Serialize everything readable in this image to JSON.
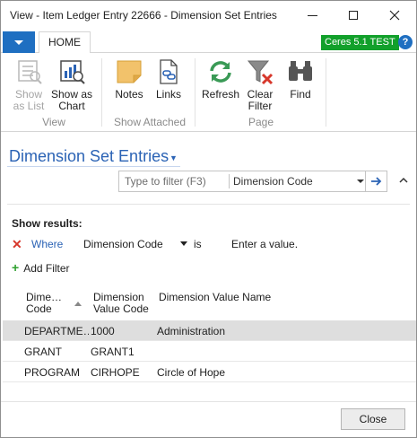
{
  "window": {
    "title": "View - Item Ledger Entry 22666 - Dimension Set Entries"
  },
  "ribbon": {
    "tab_home": "HOME",
    "env_badge": "Ceres 5.1 TEST",
    "help": "?",
    "buttons": {
      "show_as_list": "Show as List",
      "show_as_chart": "Show as Chart",
      "notes": "Notes",
      "links": "Links",
      "refresh": "Refresh",
      "clear_filter": "Clear Filter",
      "find": "Find"
    },
    "groups": {
      "view": "View",
      "show_attached": "Show Attached",
      "page": "Page"
    }
  },
  "page": {
    "title": "Dimension Set Entries",
    "search_placeholder": "Type to filter (F3)",
    "search_field": "Dimension Code"
  },
  "filters": {
    "heading": "Show results:",
    "where": "Where",
    "field": "Dimension Code",
    "operator": "is",
    "value": "Enter a value.",
    "add_filter": "Add Filter"
  },
  "grid": {
    "columns": [
      "Dime… Code",
      "Dimension Value Code",
      "Dimension Value Name"
    ],
    "col1_line1": "Dime…",
    "col1_line2": "Code",
    "col2_line1": "Dimension",
    "col2_line2": "Value Code",
    "col3_line1": "Dimension Value Name",
    "rows": [
      {
        "code": "DEPARTME…",
        "value_code": "1000",
        "value_name": "Administration",
        "selected": true
      },
      {
        "code": "GRANT",
        "value_code": "GRANT1",
        "value_name": ""
      },
      {
        "code": "PROGRAM",
        "value_code": "CIRHOPE",
        "value_name": "Circle of Hope"
      }
    ]
  },
  "footer": {
    "close": "Close"
  },
  "colors": {
    "accent": "#2b63b5",
    "app_menu": "#1f6fc1",
    "env_badge": "#12a02b",
    "remove_filter": "#d7372b",
    "add_filter": "#2fa02f",
    "selected_row": "#dedede"
  }
}
